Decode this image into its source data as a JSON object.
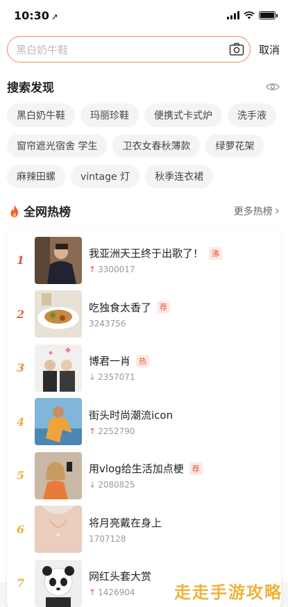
{
  "status_bar": {
    "time": "10:30",
    "location_arrow": "➚"
  },
  "search": {
    "placeholder": "黑白奶牛鞋",
    "cancel_label": "取消"
  },
  "discover": {
    "title": "搜索发现",
    "chips": [
      "黑白奶牛鞋",
      "玛丽珍鞋",
      "便携式卡式炉",
      "洗手液",
      "窗帘遮光宿舍 学生",
      "卫衣女春秋薄款",
      "绿萝花架",
      "麻辣田螺",
      "vintage 灯",
      "秋季连衣裙"
    ]
  },
  "hot": {
    "title": "全网热榜",
    "more_label": "更多热榜",
    "more_chevron": "›",
    "items": [
      {
        "rank": "1",
        "rank_color": "#d8583e",
        "title": "我亚洲天王终于出歌了！",
        "badge": "沸",
        "trend": "up",
        "trend_glyph": "↑",
        "count": "3300017"
      },
      {
        "rank": "2",
        "rank_color": "#e2703b",
        "title": "吃独食太香了",
        "badge": "荐",
        "trend": "none",
        "trend_glyph": "",
        "count": "3243756"
      },
      {
        "rank": "3",
        "rank_color": "#ec8a35",
        "title": "博君一肖",
        "badge": "热",
        "trend": "down",
        "trend_glyph": "↓",
        "count": "2357071"
      },
      {
        "rank": "4",
        "rank_color": "#e9b23e",
        "title": "街头时尚潮流icon",
        "badge": "",
        "trend": "up",
        "trend_glyph": "↑",
        "count": "2252790"
      },
      {
        "rank": "5",
        "rank_color": "#e9b23e",
        "title": "用vlog给生活加点梗",
        "badge": "荐",
        "trend": "down",
        "trend_glyph": "↓",
        "count": "2080825"
      },
      {
        "rank": "6",
        "rank_color": "#e9b23e",
        "title": "将月亮戴在身上",
        "badge": "",
        "trend": "none",
        "trend_glyph": "",
        "count": "1707128"
      },
      {
        "rank": "7",
        "rank_color": "#e9b23e",
        "title": "网红头套大赏",
        "badge": "",
        "trend": "up",
        "trend_glyph": "↑",
        "count": "1426904"
      }
    ]
  },
  "watermark": "走走手游攻略",
  "colors": {
    "accent": "#f08a5d",
    "badge_text": "#e2553f",
    "badge_bg": "#fde9e4"
  }
}
